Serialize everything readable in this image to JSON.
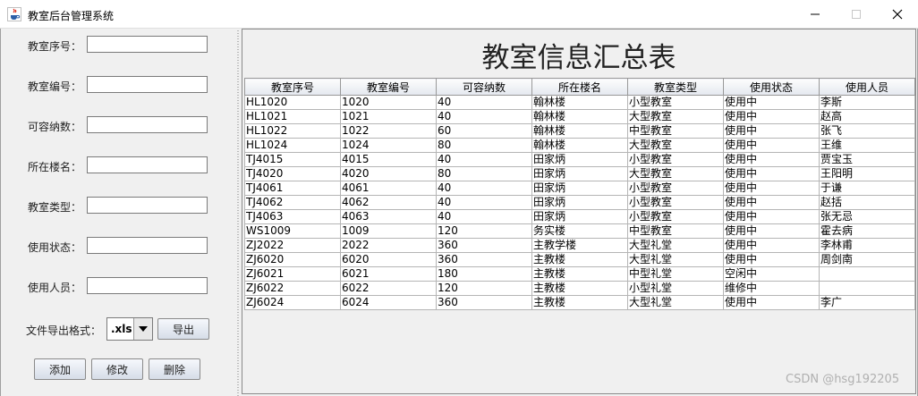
{
  "window": {
    "title": "教室后台管理系统",
    "icon": "java-cup-icon"
  },
  "form": {
    "fields": [
      {
        "label": "教室序号：",
        "value": ""
      },
      {
        "label": "教室编号：",
        "value": ""
      },
      {
        "label": "可容纳数：",
        "value": ""
      },
      {
        "label": "所在楼名：",
        "value": ""
      },
      {
        "label": "教室类型：",
        "value": ""
      },
      {
        "label": "使用状态：",
        "value": ""
      },
      {
        "label": "使用人员：",
        "value": ""
      }
    ],
    "export_label": "文件导出格式：",
    "export_format": ".xls",
    "export_button": "导出",
    "add_button": "添加",
    "edit_button": "修改",
    "delete_button": "删除"
  },
  "table": {
    "title": "教室信息汇总表",
    "headers": [
      "教室序号",
      "教室编号",
      "可容纳数",
      "所在楼名",
      "教室类型",
      "使用状态",
      "使用人员"
    ],
    "rows": [
      [
        "HL1020",
        "1020",
        "40",
        "翰林楼",
        "小型教室",
        "使用中",
        "李斯"
      ],
      [
        "HL1021",
        "1021",
        "40",
        "翰林楼",
        "大型教室",
        "使用中",
        "赵高"
      ],
      [
        "HL1022",
        "1022",
        "60",
        "翰林楼",
        "中型教室",
        "使用中",
        "张飞"
      ],
      [
        "HL1024",
        "1024",
        "80",
        "翰林楼",
        "大型教室",
        "使用中",
        "王维"
      ],
      [
        "TJ4015",
        "4015",
        "40",
        "田家炳",
        "小型教室",
        "使用中",
        "贾宝玉"
      ],
      [
        "TJ4020",
        "4020",
        "80",
        "田家炳",
        "大型教室",
        "使用中",
        "王阳明"
      ],
      [
        "TJ4061",
        "4061",
        "40",
        "田家炳",
        "小型教室",
        "使用中",
        "于谦"
      ],
      [
        "TJ4062",
        "4062",
        "40",
        "田家炳",
        "小型教室",
        "使用中",
        "赵括"
      ],
      [
        "TJ4063",
        "4063",
        "40",
        "田家炳",
        "小型教室",
        "使用中",
        "张无忌"
      ],
      [
        "WS1009",
        "1009",
        "120",
        "务实楼",
        "中型教室",
        "使用中",
        "霍去病"
      ],
      [
        "ZJ2022",
        "2022",
        "360",
        "主教学楼",
        "大型礼堂",
        "使用中",
        "李林甫"
      ],
      [
        "ZJ6020",
        "6020",
        "360",
        "主教楼",
        "大型礼堂",
        "使用中",
        "周剑南"
      ],
      [
        "ZJ6021",
        "6021",
        "180",
        "主教楼",
        "中型礼堂",
        "空闲中",
        ""
      ],
      [
        "ZJ6022",
        "6022",
        "120",
        "主教楼",
        "小型礼堂",
        "维修中",
        ""
      ],
      [
        "ZJ6024",
        "6024",
        "360",
        "主教楼",
        "大型礼堂",
        "使用中",
        "李广"
      ]
    ]
  },
  "watermark": "CSDN @hsg192205"
}
